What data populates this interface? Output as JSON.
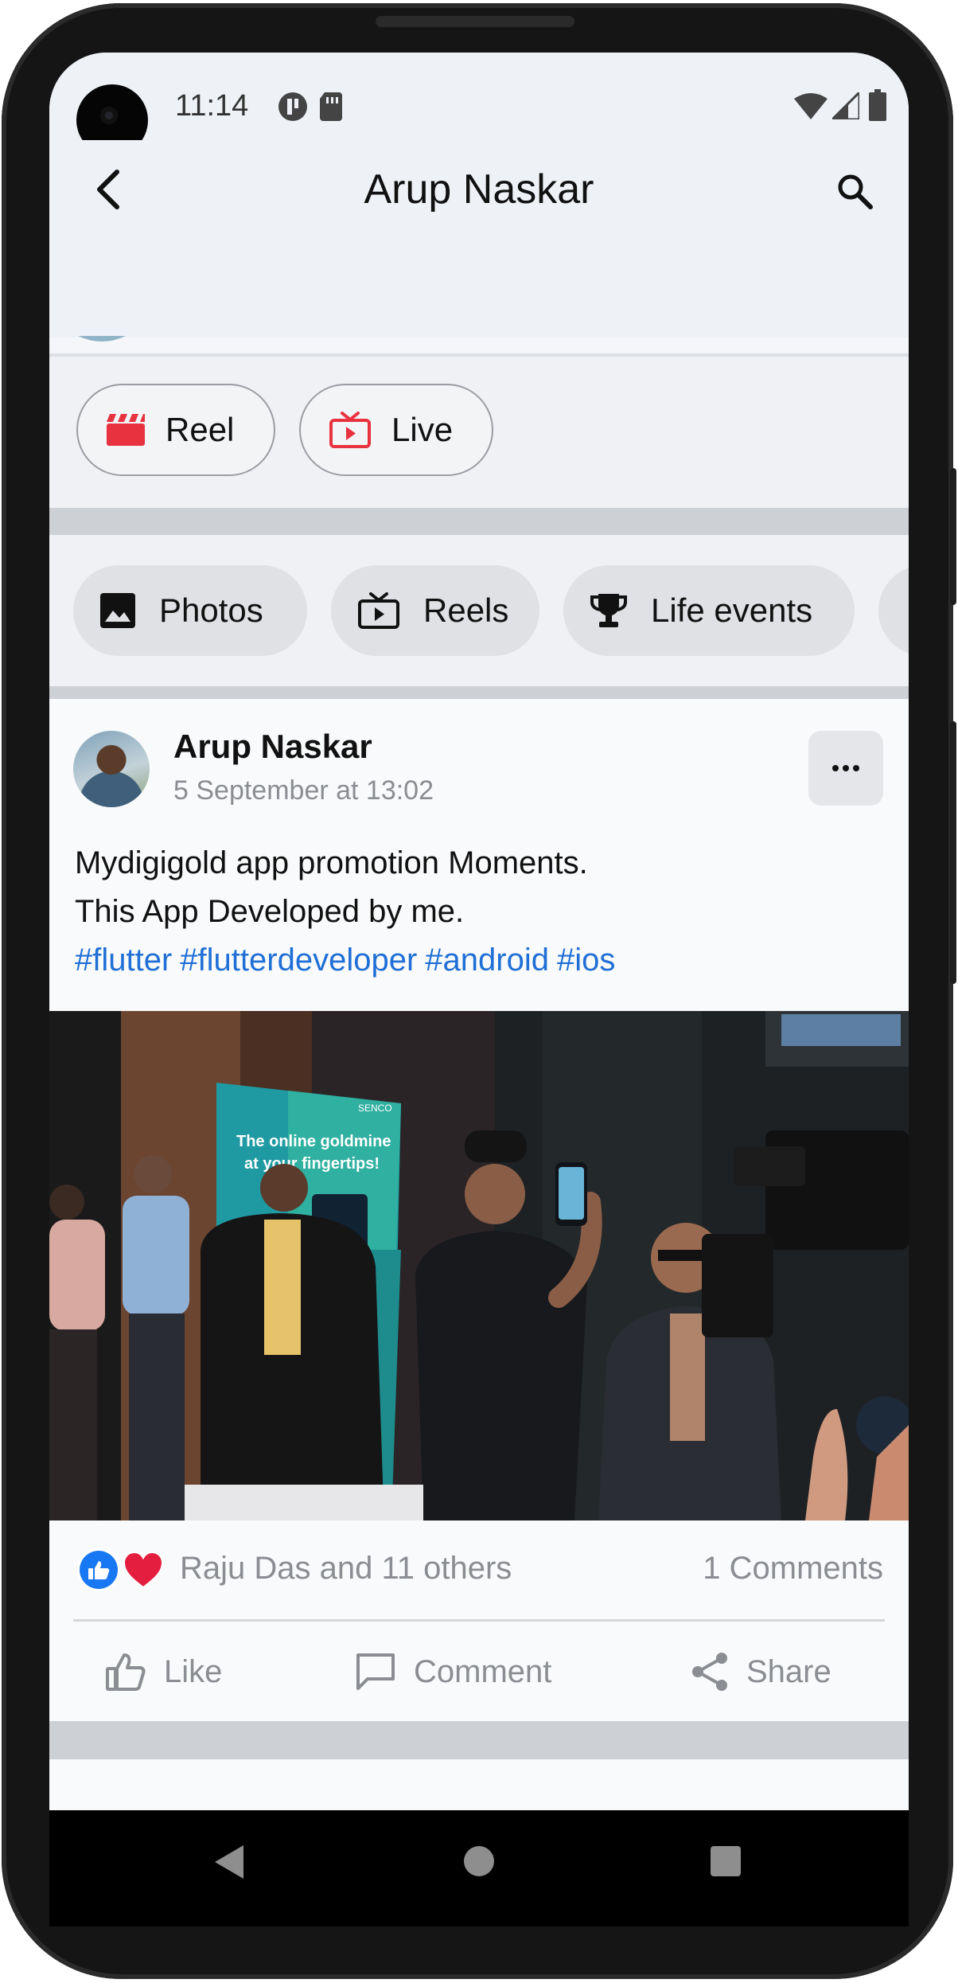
{
  "status_bar": {
    "time": "11:14"
  },
  "app_bar": {
    "title": "Arup Naskar"
  },
  "create_chips": [
    {
      "label": "Reel",
      "icon": "clapperboard-icon"
    },
    {
      "label": "Live",
      "icon": "live-tv-icon"
    }
  ],
  "filter_chips": [
    {
      "label": "Photos",
      "icon": "image-icon"
    },
    {
      "label": "Reels",
      "icon": "reels-icon"
    },
    {
      "label": "Life events",
      "icon": "trophy-icon"
    }
  ],
  "post": {
    "author": "Arup Naskar",
    "timestamp": "5 September at 13:02",
    "text_line_1": "Mydigigold app promotion Moments.",
    "text_line_2": "This App Developed by me.",
    "hashtags": [
      "#flutter",
      "#flutterdeveloper",
      "#android",
      "#ios"
    ],
    "photo": {
      "banner_line_1": "The online goldmine",
      "banner_line_2": "at your fingertips!",
      "banner_brand": "SENCO"
    },
    "reactions": {
      "summary": "Raju Das and 11 others",
      "comments": "1 Comments"
    },
    "actions": {
      "like": "Like",
      "comment": "Comment",
      "share": "Share"
    }
  },
  "colors": {
    "accent_red": "#e8323f",
    "link_blue": "#1f6fd6",
    "like_blue": "#1877f2",
    "heart_red": "#e41e3f"
  }
}
